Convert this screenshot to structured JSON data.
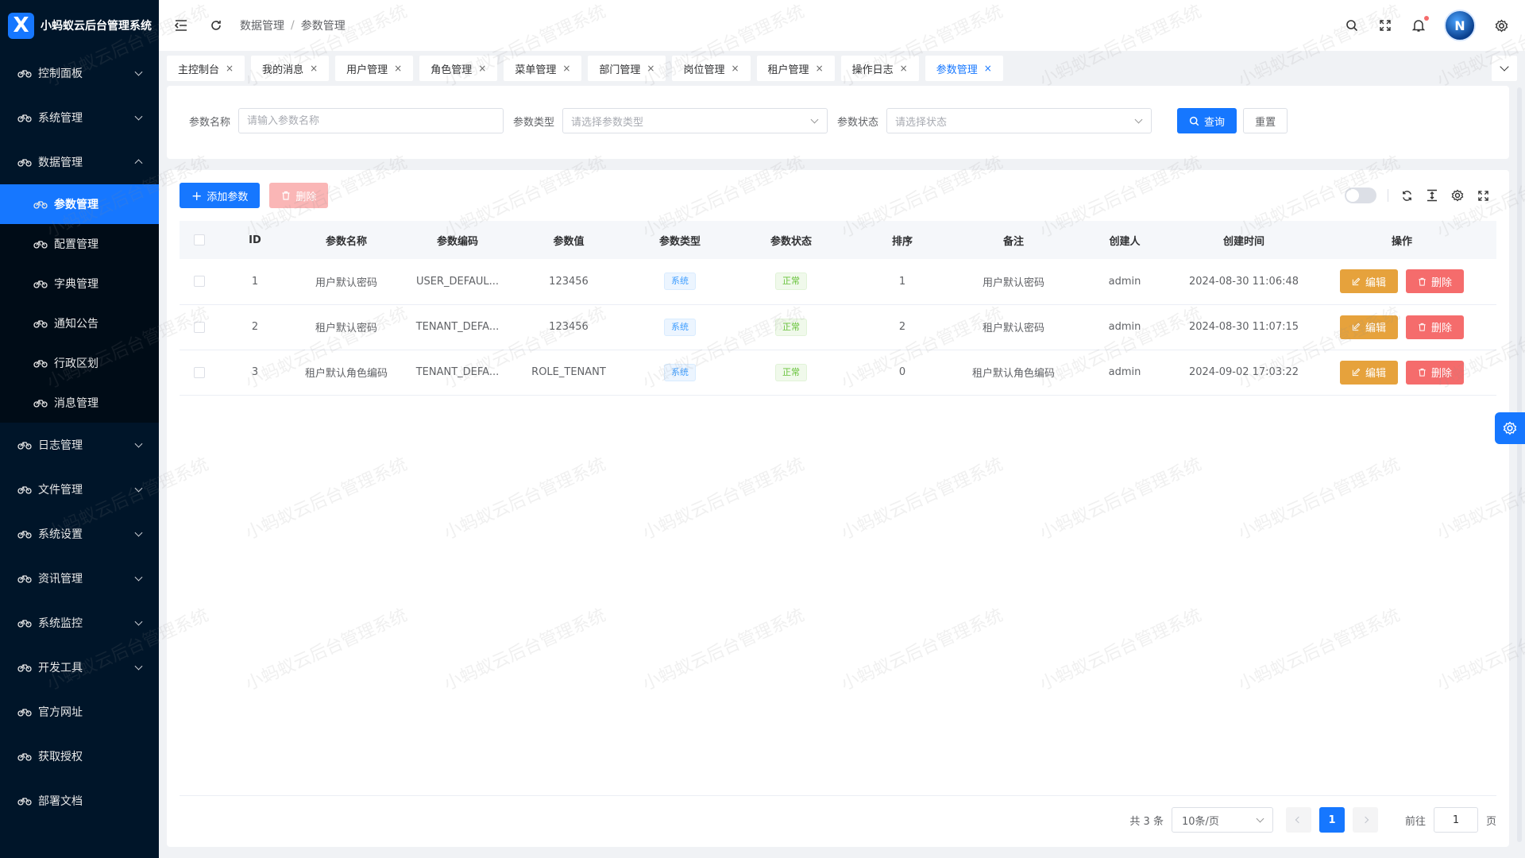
{
  "app": {
    "logo_letter": "X",
    "title": "小蚂蚁云后台管理系统"
  },
  "sidebar": {
    "items": [
      {
        "label": "控制面板",
        "has_children": true
      },
      {
        "label": "系统管理",
        "has_children": true
      },
      {
        "label": "数据管理",
        "has_children": true,
        "open": true
      },
      {
        "label": "日志管理",
        "has_children": true
      },
      {
        "label": "文件管理",
        "has_children": true
      },
      {
        "label": "系统设置",
        "has_children": true
      },
      {
        "label": "资讯管理",
        "has_children": true
      },
      {
        "label": "系统监控",
        "has_children": true
      },
      {
        "label": "开发工具",
        "has_children": true
      },
      {
        "label": "官方网址",
        "has_children": false
      },
      {
        "label": "获取授权",
        "has_children": false
      },
      {
        "label": "部署文档",
        "has_children": false
      }
    ],
    "submenu": [
      {
        "label": "参数管理",
        "active": true
      },
      {
        "label": "配置管理"
      },
      {
        "label": "字典管理"
      },
      {
        "label": "通知公告"
      },
      {
        "label": "行政区划"
      },
      {
        "label": "消息管理"
      }
    ]
  },
  "header": {
    "breadcrumb": [
      "数据管理",
      "参数管理"
    ],
    "breadcrumb_sep": "/",
    "avatar_text": "N"
  },
  "tabs": [
    {
      "label": "主控制台",
      "close": "×"
    },
    {
      "label": "我的消息",
      "close": "×"
    },
    {
      "label": "用户管理",
      "close": "×"
    },
    {
      "label": "角色管理",
      "close": "×"
    },
    {
      "label": "菜单管理",
      "close": "×"
    },
    {
      "label": "部门管理",
      "close": "×"
    },
    {
      "label": "岗位管理",
      "close": "×"
    },
    {
      "label": "租户管理",
      "close": "×"
    },
    {
      "label": "操作日志",
      "close": "×"
    },
    {
      "label": "参数管理",
      "close": "×",
      "active": true
    }
  ],
  "search": {
    "name_label": "参数名称",
    "name_placeholder": "请输入参数名称",
    "type_label": "参数类型",
    "type_placeholder": "请选择参数类型",
    "status_label": "参数状态",
    "status_placeholder": "请选择状态",
    "query_label": "查询",
    "reset_label": "重置"
  },
  "toolbar": {
    "add_label": "添加参数",
    "delete_label": "删除"
  },
  "table": {
    "columns": [
      "ID",
      "参数名称",
      "参数编码",
      "参数值",
      "参数类型",
      "参数状态",
      "排序",
      "备注",
      "创建人",
      "创建时间",
      "操作"
    ],
    "rows": [
      {
        "id": "1",
        "name": "用户默认密码",
        "code": "USER_DEFAUL...",
        "value": "123456",
        "type": "系统",
        "status": "正常",
        "sort": "1",
        "remark": "用户默认密码",
        "creator": "admin",
        "created": "2024-08-30 11:06:48"
      },
      {
        "id": "2",
        "name": "租户默认密码",
        "code": "TENANT_DEFA...",
        "value": "123456",
        "type": "系统",
        "status": "正常",
        "sort": "2",
        "remark": "租户默认密码",
        "creator": "admin",
        "created": "2024-08-30 11:07:15"
      },
      {
        "id": "3",
        "name": "租户默认角色编码",
        "code": "TENANT_DEFA...",
        "value": "ROLE_TENANT",
        "type": "系统",
        "status": "正常",
        "sort": "0",
        "remark": "租户默认角色编码",
        "creator": "admin",
        "created": "2024-09-02 17:03:22"
      }
    ],
    "edit_label": "编辑",
    "delete_label": "删除"
  },
  "pagination": {
    "total_text": "共 3 条",
    "page_size": "10条/页",
    "current_page": "1",
    "goto_prefix": "前往",
    "goto_value": "1",
    "goto_suffix": "页"
  },
  "watermark": "小蚂蚁云后台管理系统",
  "colors": {
    "primary": "#1677ff",
    "sidebar_bg": "#001529",
    "warning": "#e6a23c",
    "danger": "#f56c6c"
  }
}
